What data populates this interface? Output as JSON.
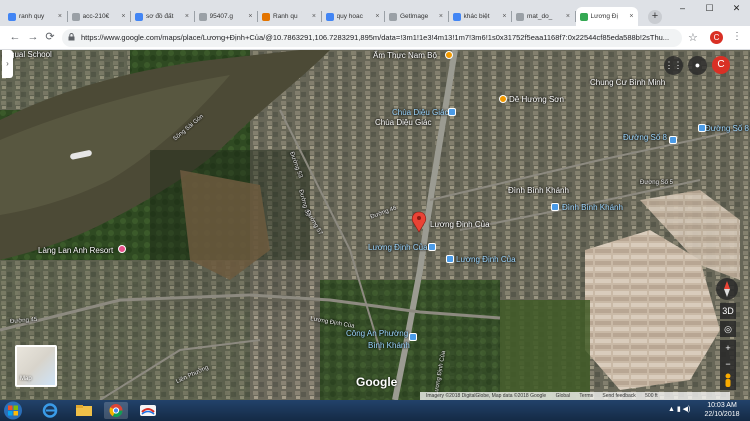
{
  "tabs": [
    {
      "label": "ranh quy",
      "favicon_color": "#4285f4"
    },
    {
      "label": "acc-210€",
      "favicon_color": "#9aa0a6"
    },
    {
      "label": "sơ đồ đất",
      "favicon_color": "#4285f4"
    },
    {
      "label": "95407.g",
      "favicon_color": "#9aa0a6"
    },
    {
      "label": "Ranh qu",
      "favicon_color": "#e37400"
    },
    {
      "label": "quy hoac",
      "favicon_color": "#4285f4"
    },
    {
      "label": "Getlmage",
      "favicon_color": "#9aa0a6"
    },
    {
      "label": "khác biệt",
      "favicon_color": "#4285f4"
    },
    {
      "label": "mat_do_",
      "favicon_color": "#9aa0a6"
    },
    {
      "label": "Lương Đị",
      "favicon_color": "#34a853"
    }
  ],
  "url": "https://www.google.com/maps/place/Lương+Định+Của/@10.7863291,106.7283291,895m/data=!3m1!1e3!4m13!1m7!3m6!1s0x31752f5eaa1168f7:0x22544cf85eda588b!2sThu...",
  "avatar_letter": "C",
  "map": {
    "labels": [
      {
        "text": "lingual School",
        "style": "white"
      },
      {
        "text": "Ẩm Thực Nam Bộ",
        "style": "white"
      },
      {
        "text": "Chung Cư Bình Minh",
        "style": "white"
      },
      {
        "text": "Dê Hương Sơn",
        "style": "white"
      },
      {
        "text": "Chùa Diệu Giác",
        "style": "blue"
      },
      {
        "text": "Chùa Diệu Giác",
        "style": "white"
      },
      {
        "text": "Đường Số 8",
        "style": "blue"
      },
      {
        "text": "Đường Số 8",
        "style": "blue"
      },
      {
        "text": "Đình Bình Khánh",
        "style": "white"
      },
      {
        "text": "Đình Bình Khánh",
        "style": "blue"
      },
      {
        "text": "Lương Định Của",
        "style": "white"
      },
      {
        "text": "Lương Định Của",
        "style": "blue"
      },
      {
        "text": "Lương Định Của",
        "style": "blue"
      },
      {
        "text": "Làng Lan Anh Resort",
        "style": "white"
      },
      {
        "text": "Công An Phường",
        "style": "blue"
      },
      {
        "text": "Bình Khánh",
        "style": "blue"
      },
      {
        "text": "Sông Sài Gòn",
        "style": "small"
      },
      {
        "text": "Đường 53",
        "style": "small"
      },
      {
        "text": "Đường 46",
        "style": "small"
      },
      {
        "text": "Đường 59",
        "style": "small"
      },
      {
        "text": "Đường 57",
        "style": "small"
      },
      {
        "text": "Đường 45",
        "style": "small"
      },
      {
        "text": "Lương Định Của",
        "style": "small"
      },
      {
        "text": "Liên Phường",
        "style": "small"
      },
      {
        "text": "Đường Số 5",
        "style": "small"
      },
      {
        "text": "Lương Định Của",
        "style": "small"
      }
    ],
    "layer_thumb_label": "Map",
    "google_logo": "Google",
    "attribution": [
      "Imagery ©2018 DigitalGlobe, Map data ©2018 Google",
      "Global",
      "Terms",
      "Send feedback",
      "500 ft"
    ],
    "controls": {
      "zoom_in": "+",
      "zoom_out": "−",
      "view_3d": "3D"
    }
  },
  "taskbar": {
    "time": "10:03 AM",
    "date": "22/10/2018"
  }
}
